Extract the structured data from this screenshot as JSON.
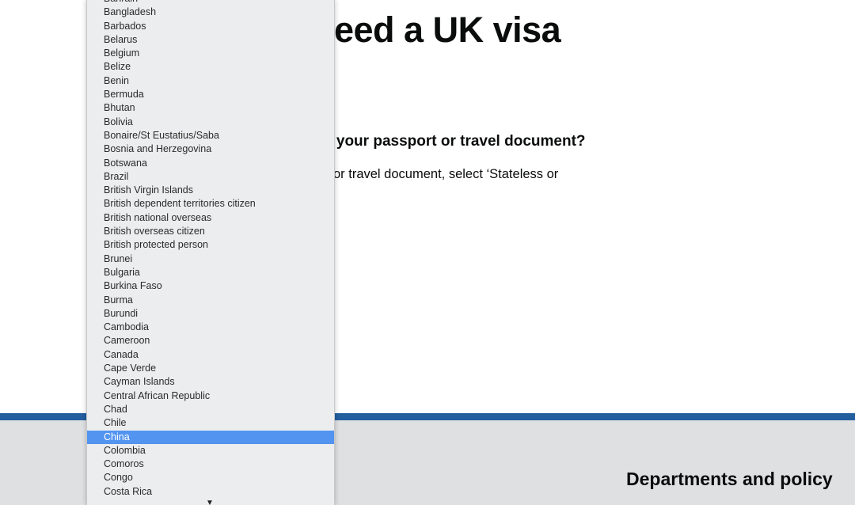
{
  "page": {
    "title_fragment": "eed a UK visa",
    "question_fragment": "n your passport or travel document?",
    "hint_fragment": "or travel document, select ‘Stateless or"
  },
  "footer": {
    "link": "Departments and policy"
  },
  "colors": {
    "band": "#235e9f",
    "footer": "#dee0e2",
    "selected": "#5294f0"
  },
  "dropdown": {
    "selected": "China",
    "items": [
      "Bahrain",
      "Bangladesh",
      "Barbados",
      "Belarus",
      "Belgium",
      "Belize",
      "Benin",
      "Bermuda",
      "Bhutan",
      "Bolivia",
      "Bonaire/St Eustatius/Saba",
      "Bosnia and Herzegovina",
      "Botswana",
      "Brazil",
      "British Virgin Islands",
      "British dependent territories citizen",
      "British national overseas",
      "British overseas citizen",
      "British protected person",
      "Brunei",
      "Bulgaria",
      "Burkina Faso",
      "Burma",
      "Burundi",
      "Cambodia",
      "Cameroon",
      "Canada",
      "Cape Verde",
      "Cayman Islands",
      "Central African Republic",
      "Chad",
      "Chile",
      "China",
      "Colombia",
      "Comoros",
      "Congo",
      "Costa Rica"
    ],
    "scroll_icon": "triangle-down"
  }
}
